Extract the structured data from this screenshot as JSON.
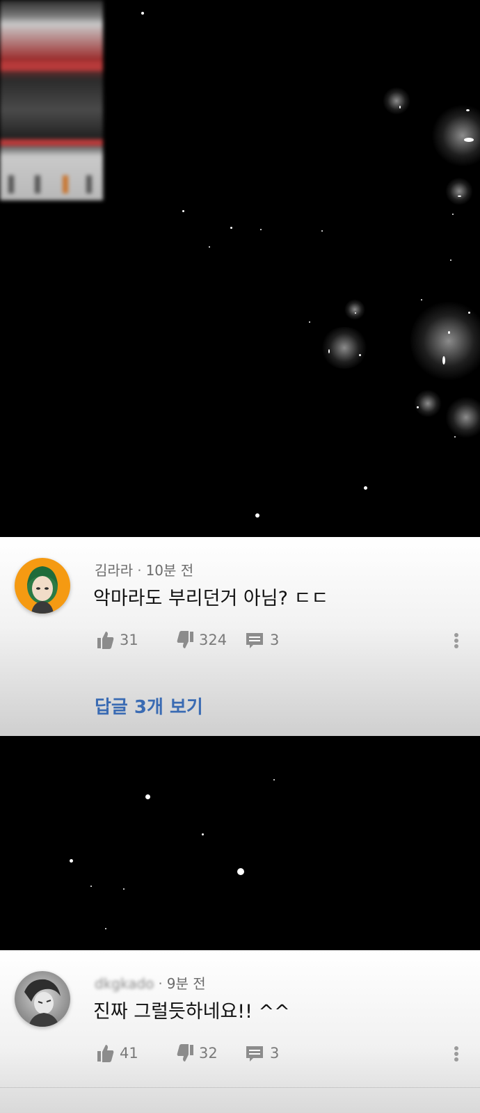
{
  "comments": [
    {
      "author": "김라라",
      "separator": "·",
      "time": "10분 전",
      "text": "악마라도 부리던거 아님? ㄷㄷ",
      "likes": "31",
      "dislikes": "324",
      "replies": "3",
      "view_replies_label": "답글 3개 보기"
    },
    {
      "author": "dkgkado",
      "separator": "·",
      "time": "9분 전",
      "text": "진짜 그럴듯하네요!! ^^",
      "likes": "41",
      "dislikes": "32",
      "replies": "3"
    }
  ],
  "icons": {
    "like": "thumbs-up-icon",
    "dislike": "thumbs-down-icon",
    "reply": "comment-icon",
    "more": "more-vertical-icon"
  },
  "colors": {
    "link": "#3a6bb3",
    "avatar_1_bg": "#f59a12"
  }
}
